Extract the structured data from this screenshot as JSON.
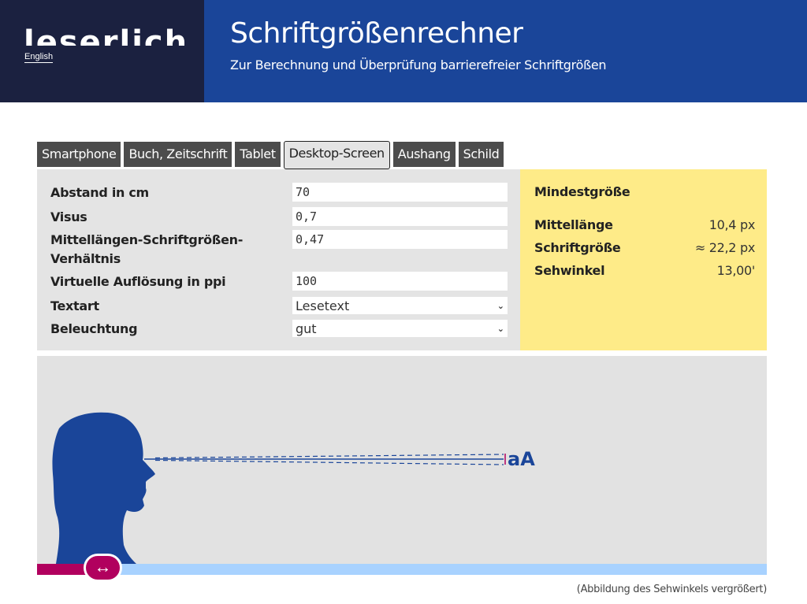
{
  "brand": {
    "logo_text": "leserlich",
    "language_link": "English"
  },
  "header": {
    "title": "Schriftgrößenrechner",
    "subtitle": "Zur Berechnung und Überprüfung barrierefreier Schriftgrößen"
  },
  "tabs": [
    {
      "label": "Smartphone",
      "active": false
    },
    {
      "label": "Buch, Zeitschrift",
      "active": false
    },
    {
      "label": "Tablet",
      "active": false
    },
    {
      "label": "Desktop-Screen",
      "active": true
    },
    {
      "label": "Aushang",
      "active": false
    },
    {
      "label": "Schild",
      "active": false
    }
  ],
  "form": {
    "distance": {
      "label": "Abstand in cm",
      "value": "70"
    },
    "visus": {
      "label": "Visus",
      "value": "0,7"
    },
    "ratio": {
      "label_line1": "Mittellängen-Schriftgrößen-",
      "label_line2": "Verhältnis",
      "value": "0,47"
    },
    "resolution": {
      "label": "Virtuelle Auflösung in ppi",
      "value": "100"
    },
    "text_type": {
      "label": "Textart",
      "selected": "Lesetext"
    },
    "lighting": {
      "label": "Beleuchtung",
      "selected": "gut"
    }
  },
  "results": {
    "title": "Mindestgröße",
    "rows": [
      {
        "label": "Mittellänge",
        "value": "10,4 px"
      },
      {
        "label": "Schriftgröße",
        "value": "≈ 22,2 px"
      },
      {
        "label": "Sehwinkel",
        "value": "13,00'"
      }
    ]
  },
  "illustration": {
    "sample_text": "aA",
    "slider_icon": "↔",
    "slider_position_fraction": 0.09,
    "caption": "(Abbildung des Sehwinkels vergrößert)"
  },
  "colors": {
    "brand_dark": "#1b2140",
    "banner_blue": "#1a4599",
    "figure_blue": "#1a4599",
    "result_yellow": "#feeb88",
    "accent_magenta": "#b1005e",
    "track_light_blue": "#a8d2ff"
  }
}
